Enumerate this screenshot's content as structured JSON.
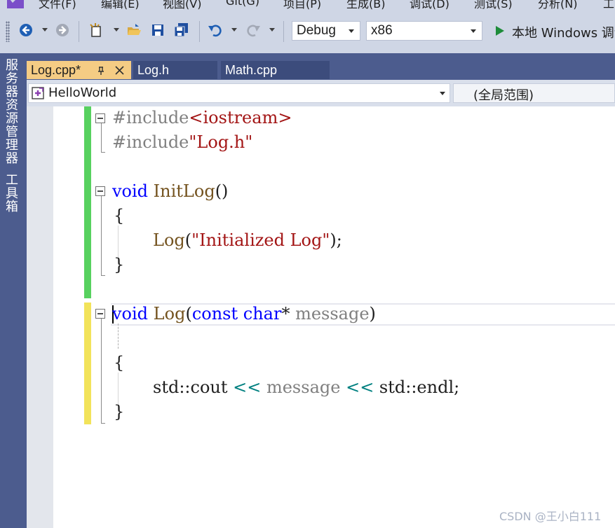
{
  "menubar": {
    "items": [
      {
        "label": "文件(F)"
      },
      {
        "label": "编辑(E)"
      },
      {
        "label": "视图(V)"
      },
      {
        "label": "Git(G)"
      },
      {
        "label": "项目(P)"
      },
      {
        "label": "生成(B)"
      },
      {
        "label": "调试(D)"
      },
      {
        "label": "测试(S)"
      },
      {
        "label": "分析(N)"
      },
      {
        "label": "工"
      }
    ]
  },
  "toolbar": {
    "configuration": "Debug",
    "platform": "x86",
    "run_label": "本地 Windows 调试器"
  },
  "sidedock": {
    "tabs": [
      {
        "label": "服务器资源管理器"
      },
      {
        "label": "工具箱"
      }
    ]
  },
  "tabs": [
    {
      "label": "Log.cpp*",
      "active": true
    },
    {
      "label": "Log.h",
      "active": false
    },
    {
      "label": "Math.cpp",
      "active": false
    }
  ],
  "navbar": {
    "project": "HelloWorld",
    "scope": "(全局范围)"
  },
  "code": {
    "line1": {
      "directive": "#include",
      "path": "<iostream>"
    },
    "line2": {
      "directive": "#include",
      "path": "\"Log.h\""
    },
    "line4": {
      "kw": "void",
      "name": " InitLog",
      "parens": "()"
    },
    "line5": {
      "brace": "{"
    },
    "line6": {
      "call": "Log",
      "open": "(",
      "arg": "\"Initialized Log\"",
      "close": ");"
    },
    "line7": {
      "brace": "}"
    },
    "line9": {
      "kw": "void",
      "name": " Log",
      "open": "(",
      "const": "const",
      "type": " char",
      "star": "*",
      "param": " message",
      "close": ")"
    },
    "line11": {
      "brace": "{"
    },
    "line12": {
      "ns1": "std::cout ",
      "op1": "<<",
      "param": " message ",
      "op2": "<<",
      "ns2": " std::endl;"
    },
    "line13": {
      "brace": "}"
    }
  },
  "colors": {
    "keyword": "#0000ff",
    "string": "#a31515",
    "function": "#74531f",
    "preprocessor": "#808080",
    "change_saved": "#57d15f",
    "change_unsaved": "#f2e35a"
  },
  "watermark": "CSDN @王小白111"
}
